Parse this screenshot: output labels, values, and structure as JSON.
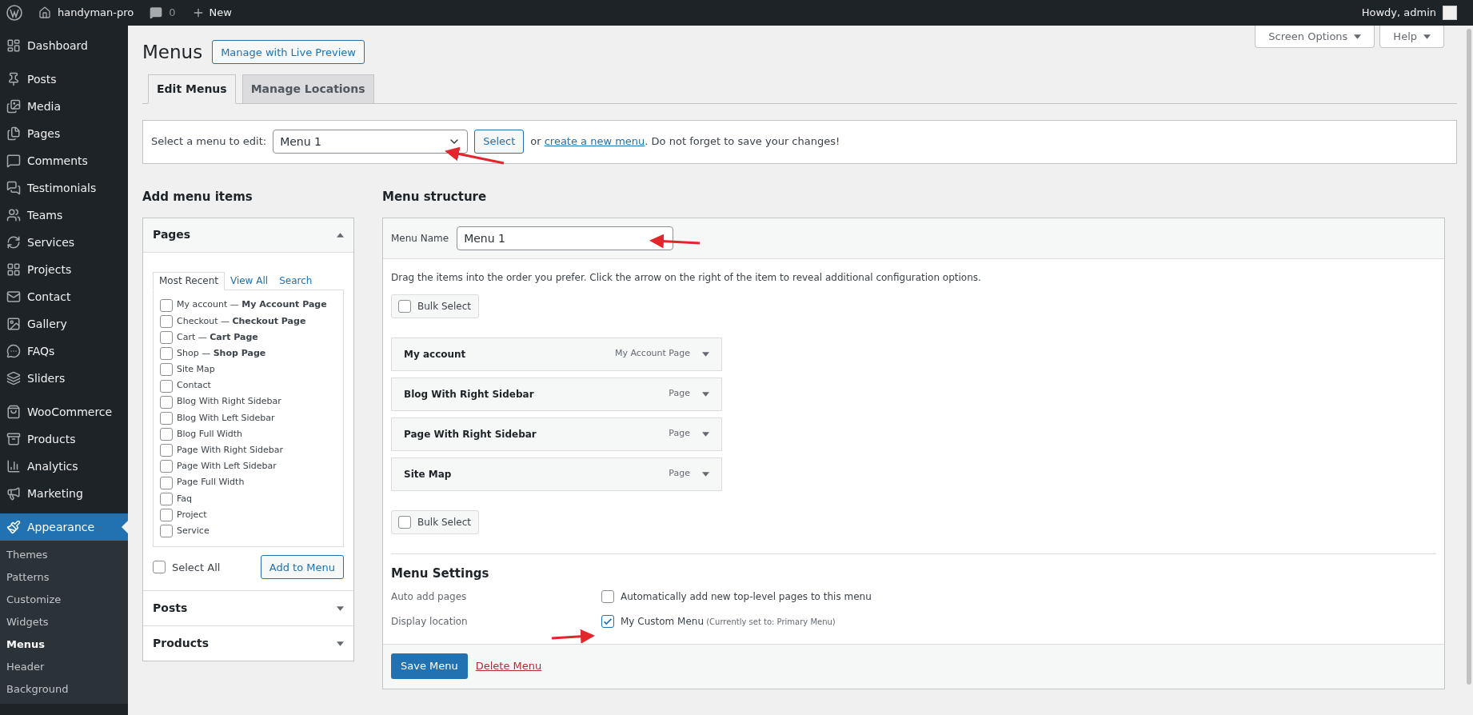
{
  "admin_bar": {
    "site_name": "handyman-pro",
    "comments_count": "0",
    "new_label": "New",
    "greeting": "Howdy, admin"
  },
  "sidebar": {
    "groups": [
      {
        "items": [
          {
            "label": "Dashboard",
            "selected": false
          }
        ]
      },
      {
        "items": [
          {
            "label": "Posts",
            "selected": false
          },
          {
            "label": "Media",
            "selected": false
          },
          {
            "label": "Pages",
            "selected": false
          },
          {
            "label": "Comments",
            "selected": false
          },
          {
            "label": "Testimonials",
            "selected": false
          },
          {
            "label": "Teams",
            "selected": false
          },
          {
            "label": "Services",
            "selected": false
          },
          {
            "label": "Projects",
            "selected": false
          },
          {
            "label": "Contact",
            "selected": false
          },
          {
            "label": "Gallery",
            "selected": false
          },
          {
            "label": "FAQs",
            "selected": false
          },
          {
            "label": "Sliders",
            "selected": false
          }
        ]
      },
      {
        "items": [
          {
            "label": "WooCommerce",
            "selected": false
          },
          {
            "label": "Products",
            "selected": false
          },
          {
            "label": "Analytics",
            "selected": false
          },
          {
            "label": "Marketing",
            "selected": false
          }
        ]
      },
      {
        "items": [
          {
            "label": "Appearance",
            "selected": true,
            "children": [
              {
                "label": "Themes",
                "selected": false
              },
              {
                "label": "Patterns",
                "selected": false
              },
              {
                "label": "Customize",
                "selected": false
              },
              {
                "label": "Widgets",
                "selected": false
              },
              {
                "label": "Menus",
                "selected": true
              },
              {
                "label": "Header",
                "selected": false
              },
              {
                "label": "Background",
                "selected": false
              }
            ]
          }
        ]
      }
    ]
  },
  "header": {
    "title": "Menus",
    "live_preview_button": "Manage with Live Preview",
    "screen_options": "Screen Options",
    "help": "Help"
  },
  "tabs": [
    {
      "label": "Edit Menus",
      "selected": true
    },
    {
      "label": "Manage Locations",
      "selected": false
    }
  ],
  "menu_select": {
    "label": "Select a menu to edit:",
    "value": "Menu 1",
    "button": "Select",
    "text_before": "or",
    "link": "create a new menu",
    "text_after": ". Do not forget to save your changes!"
  },
  "add_menu_items": {
    "title": "Add menu items",
    "sections": [
      {
        "title": "Pages",
        "expanded": true
      },
      {
        "title": "Posts",
        "expanded": false
      },
      {
        "title": "Products",
        "expanded": false
      }
    ],
    "page_tabs": [
      {
        "label": "Most Recent",
        "selected": true
      },
      {
        "label": "View All",
        "selected": false
      },
      {
        "label": "Search",
        "selected": false
      }
    ],
    "pages": [
      {
        "label": "My account — **My Account Page**",
        "checked": false
      },
      {
        "label": "Checkout — **Checkout Page**",
        "checked": false
      },
      {
        "label": "Cart — **Cart Page**",
        "checked": false
      },
      {
        "label": "Shop — **Shop Page**",
        "checked": false
      },
      {
        "label": "Site Map",
        "checked": false
      },
      {
        "label": "Contact",
        "checked": false
      },
      {
        "label": "Blog With Right Sidebar",
        "checked": false
      },
      {
        "label": "Blog With Left Sidebar",
        "checked": false
      },
      {
        "label": "Blog Full Width",
        "checked": false
      },
      {
        "label": "Page With Right Sidebar",
        "checked": false
      },
      {
        "label": "Page With Left Sidebar",
        "checked": false
      },
      {
        "label": "Page Full Width",
        "checked": false
      },
      {
        "label": "Faq",
        "checked": false
      },
      {
        "label": "Project",
        "checked": false
      },
      {
        "label": "Service",
        "checked": false
      }
    ],
    "select_all": {
      "label": "Select All",
      "checked": false
    },
    "add_button": "Add to Menu"
  },
  "menu_structure": {
    "title": "Menu structure",
    "name_label": "Menu Name",
    "name_value": "Menu 1",
    "instructions": "Drag the items into the order you prefer. Click the arrow on the right of the item to reveal additional configuration options.",
    "bulk_select_top": {
      "label": "Bulk Select",
      "checked": false
    },
    "items": [
      {
        "title": "My account",
        "type": "My Account Page"
      },
      {
        "title": "Blog With Right Sidebar",
        "type": "Page"
      },
      {
        "title": "Page With Right Sidebar",
        "type": "Page"
      },
      {
        "title": "Site Map",
        "type": "Page"
      }
    ],
    "bulk_select_bottom": {
      "label": "Bulk Select",
      "checked": false
    },
    "settings_title": "Menu Settings",
    "settings": [
      {
        "label": "Auto add pages",
        "option": "Automatically add new top-level pages to this menu",
        "checked": false
      },
      {
        "label": "Display location",
        "option": "My Custom Menu",
        "note": "(Currently set to: Primary Menu)",
        "checked": true
      }
    ],
    "save_button": "Save Menu",
    "delete_link": "Delete Menu"
  }
}
